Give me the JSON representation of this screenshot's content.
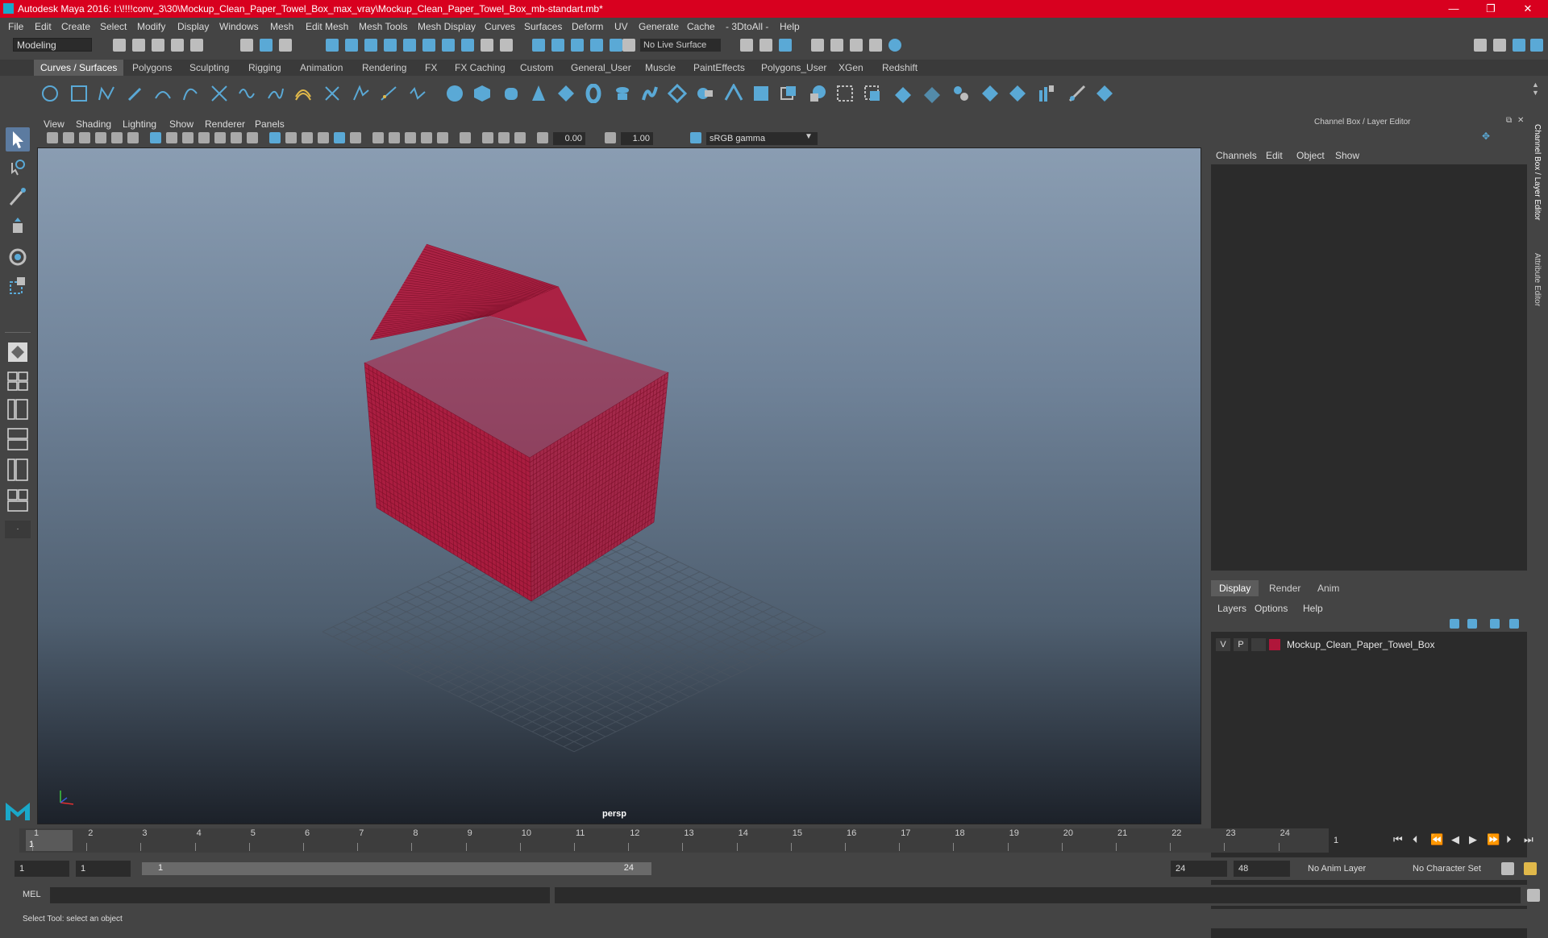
{
  "window": {
    "title": "Autodesk Maya 2016: I:\\!!!!conv_3\\30\\Mockup_Clean_Paper_Towel_Box_max_vray\\Mockup_Clean_Paper_Towel_Box_mb-standart.mb*",
    "minimize": "—",
    "restore": "❐",
    "close": "✕"
  },
  "menubar": [
    "File",
    "Edit",
    "Create",
    "Select",
    "Modify",
    "Display",
    "Windows",
    "Mesh",
    "Edit Mesh",
    "Mesh Tools",
    "Mesh Display",
    "Curves",
    "Surfaces",
    "Deform",
    "UV",
    "Generate",
    "Cache",
    "- 3DtoAll -",
    "Help"
  ],
  "statusline": {
    "mode": "Modeling",
    "live_surface": "No Live Surface"
  },
  "shelf_tabs": [
    "Curves / Surfaces",
    "Polygons",
    "Sculpting",
    "Rigging",
    "Animation",
    "Rendering",
    "FX",
    "FX Caching",
    "Custom",
    "General_User",
    "Muscle",
    "PaintEffects",
    "Polygons_User",
    "XGen",
    "Redshift"
  ],
  "viewport": {
    "menu": [
      "View",
      "Shading",
      "Lighting",
      "Show",
      "Renderer",
      "Panels"
    ],
    "exposure": "0.00",
    "gamma": "1.00",
    "color_space": "sRGB gamma",
    "camera": "persp",
    "wireframe_color": "#b0163a"
  },
  "right_panel": {
    "title": "Channel Box / Layer Editor",
    "menu": [
      "Channels",
      "Edit",
      "Object",
      "Show"
    ],
    "layer_tabs": [
      "Display",
      "Render",
      "Anim"
    ],
    "layer_menu": [
      "Layers",
      "Options",
      "Help"
    ],
    "layer": {
      "v": "V",
      "p": "P",
      "name": "Mockup_Clean_Paper_Towel_Box",
      "color": "#b0163a"
    },
    "side_tabs": [
      "Channel Box / Layer Editor",
      "Attribute Editor"
    ]
  },
  "timeline": {
    "ticks": [
      "1",
      "2",
      "3",
      "4",
      "5",
      "6",
      "7",
      "8",
      "9",
      "10",
      "11",
      "12",
      "13",
      "14",
      "15",
      "16",
      "17",
      "18",
      "19",
      "20",
      "21",
      "22",
      "23",
      "24"
    ],
    "current_frame": "1",
    "frame_field": "1"
  },
  "range": {
    "start": "1",
    "playback_start": "1",
    "range_start": "1",
    "range_end": "24",
    "playback_end": "24",
    "end": "48",
    "anim_layer": "No Anim Layer",
    "character_set": "No Character Set"
  },
  "command": {
    "language": "MEL"
  },
  "help_line": "Select Tool: select an object"
}
